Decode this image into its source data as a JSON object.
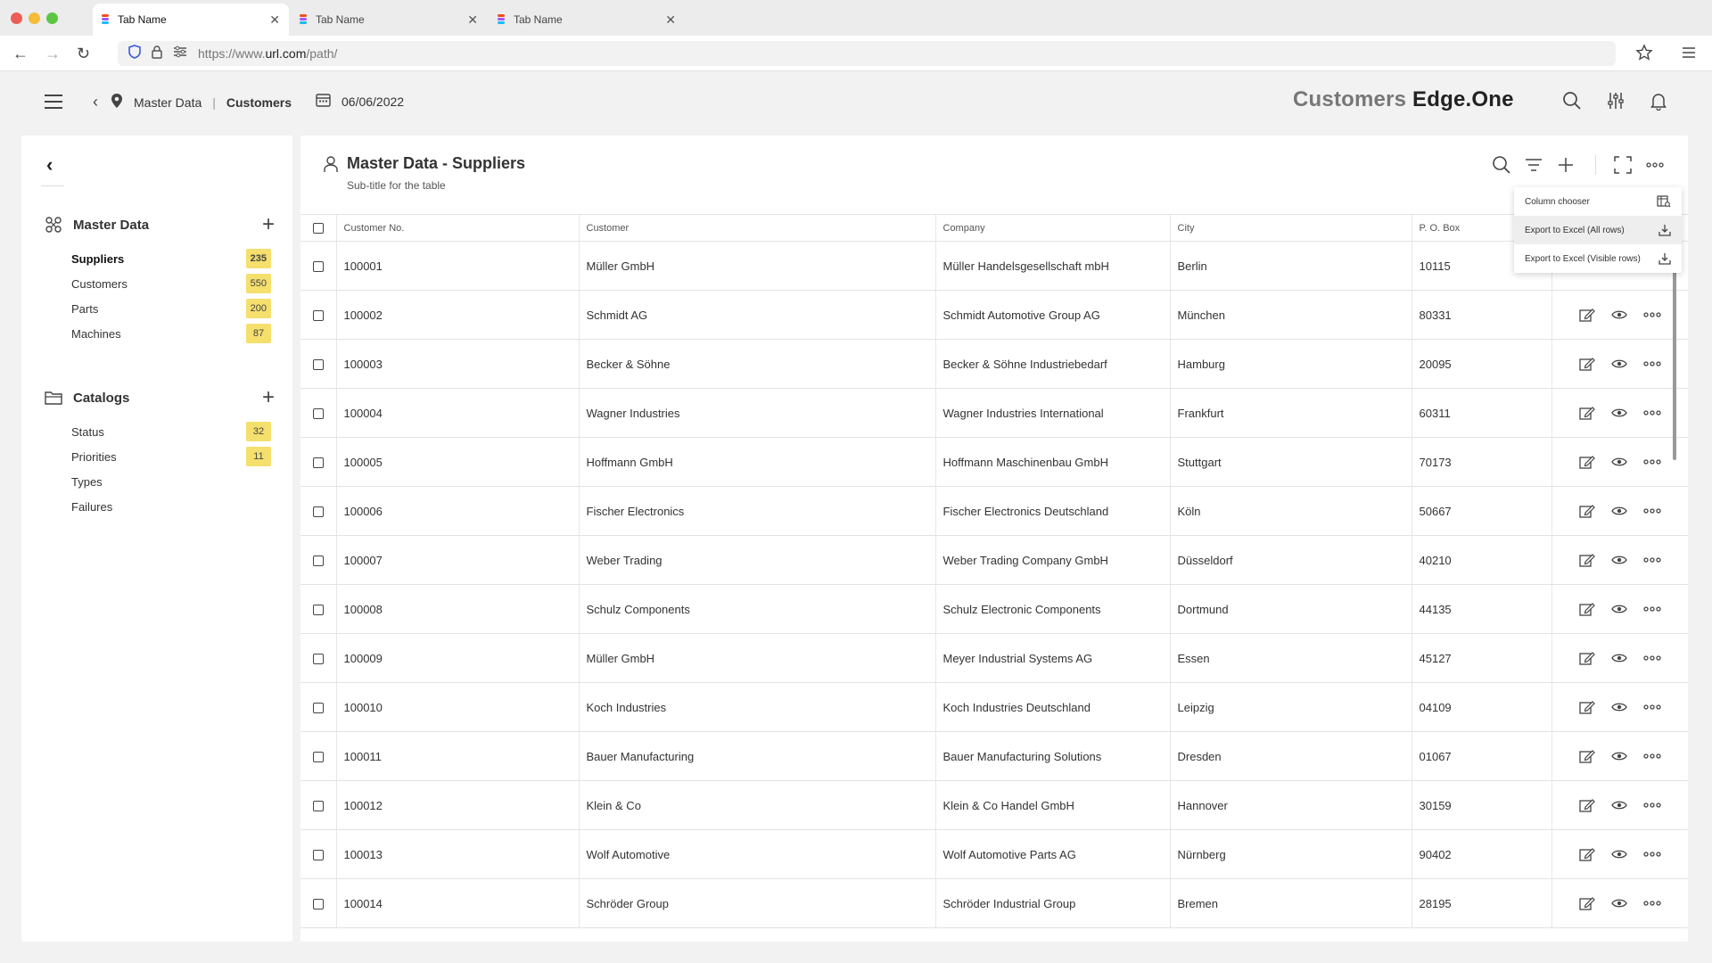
{
  "browser": {
    "tabs": [
      {
        "label": "Tab Name"
      },
      {
        "label": "Tab Name"
      },
      {
        "label": "Tab Name"
      }
    ],
    "url_prefix": "https://www.",
    "url_domain": "url.com",
    "url_path": "/path/"
  },
  "header": {
    "crumb_parent": "Master Data",
    "crumb_current": "Customers",
    "date": "06/06/2022",
    "brand_light": "Customers",
    "brand_bold": "Edge.One"
  },
  "sidebar": {
    "sections": [
      {
        "title": "Master Data",
        "items": [
          {
            "label": "Suppliers",
            "count": "235",
            "active": true
          },
          {
            "label": "Customers",
            "count": "550"
          },
          {
            "label": "Parts",
            "count": "200"
          },
          {
            "label": "Machines",
            "count": "87"
          }
        ]
      },
      {
        "title": "Catalogs",
        "items": [
          {
            "label": "Status",
            "count": "32"
          },
          {
            "label": "Priorities",
            "count": "11"
          },
          {
            "label": "Types",
            "count": ""
          },
          {
            "label": "Failures",
            "count": ""
          }
        ]
      }
    ]
  },
  "main": {
    "title": "Master Data - Suppliers",
    "subtitle": "Sub-title for the table",
    "columns": [
      "Customer No.",
      "Customer",
      "Company",
      "City",
      "P. O. Box"
    ],
    "rows": [
      [
        "100001",
        "Müller GmbH",
        "Müller Handelsgesellschaft mbH",
        "Berlin",
        "10115"
      ],
      [
        "100002",
        "Schmidt AG",
        "Schmidt Automotive Group AG",
        "München",
        "80331"
      ],
      [
        "100003",
        "Becker & Söhne",
        "Becker & Söhne Industriebedarf",
        "Hamburg",
        "20095"
      ],
      [
        "100004",
        "Wagner Industries",
        "Wagner Industries International",
        "Frankfurt",
        "60311"
      ],
      [
        "100005",
        "Hoffmann GmbH",
        "Hoffmann Maschinenbau GmbH",
        "Stuttgart",
        "70173"
      ],
      [
        "100006",
        "Fischer Electronics",
        "Fischer Electronics Deutschland",
        "Köln",
        "50667"
      ],
      [
        "100007",
        "Weber Trading",
        "Weber Trading Company GmbH",
        "Düsseldorf",
        "40210"
      ],
      [
        "100008",
        "Schulz Components",
        "Schulz Electronic Components",
        "Dortmund",
        "44135"
      ],
      [
        "100009",
        "Müller GmbH",
        "Meyer Industrial Systems AG",
        "Essen",
        "45127"
      ],
      [
        "100010",
        "Koch Industries",
        "Koch Industries Deutschland",
        "Leipzig",
        "04109"
      ],
      [
        "100011",
        "Bauer Manufacturing",
        "Bauer Manufacturing Solutions",
        "Dresden",
        "01067"
      ],
      [
        "100012",
        "Klein & Co",
        "Klein & Co Handel GmbH",
        "Hannover",
        "30159"
      ],
      [
        "100013",
        "Wolf Automotive",
        "Wolf Automotive Parts AG",
        "Nürnberg",
        "90402"
      ],
      [
        "100014",
        "Schröder Group",
        "Schröder Industrial Group",
        "Bremen",
        "28195"
      ]
    ]
  },
  "dropdown": {
    "items": [
      {
        "label": "Column chooser",
        "icon": "column-chooser-icon"
      },
      {
        "label": "Export to Excel (All rows)",
        "icon": "download-icon"
      },
      {
        "label": "Export to Excel (Visible rows)",
        "icon": "download-icon"
      }
    ]
  },
  "colors": {
    "badge": "#f5df6d",
    "background": "#f2f2f2"
  }
}
